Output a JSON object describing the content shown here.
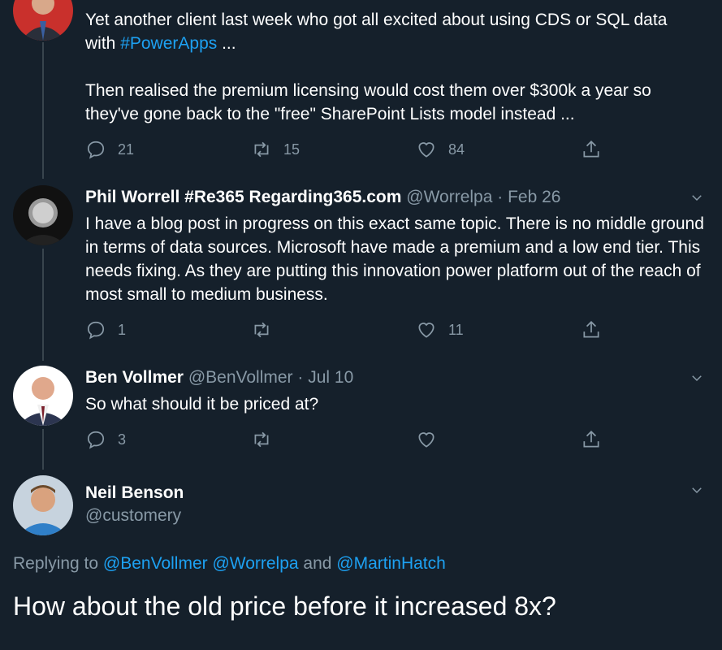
{
  "tweet1": {
    "text_line1": "Yet another client last week who got all excited about using CDS or SQL data",
    "text_line2_prefix": "with ",
    "hashtag": "#PowerApps",
    "text_line2_suffix": " ...",
    "text_para2_line1": "Then realised the premium licensing would cost them over $300k a year so",
    "text_para2_line2": "they've gone back to the \"free\" SharePoint Lists model instead ...",
    "replies": "21",
    "retweets": "15",
    "likes": "84"
  },
  "tweet2": {
    "name": "Phil Worrell #Re365 Regarding365.com",
    "handle": "@Worrelpa",
    "date": "· Feb 26",
    "text": "I have a blog post in progress on this exact same topic. There is no middle ground in terms of data sources. Microsoft have made a premium and a low end tier. This needs fixing. As they are putting this innovation power platform out of the reach of most small to medium business.",
    "replies": "1",
    "likes": "11"
  },
  "tweet3": {
    "name": "Ben Vollmer",
    "handle": "@BenVollmer",
    "date": "· Jul 10",
    "text": "So what should it be priced at?",
    "replies": "3"
  },
  "tweet4": {
    "name": "Neil Benson",
    "handle": "@customery",
    "replying_prefix": "Replying to ",
    "replying_to": "@BenVollmer @Worrelpa",
    "replying_and": " and ",
    "replying_last": "@MartinHatch",
    "text": "How about the old price before it increased 8x?"
  },
  "icons": {
    "reply": "reply-icon",
    "retweet": "retweet-icon",
    "like": "heart-icon",
    "share": "share-icon",
    "more": "chevron-down-icon"
  },
  "colors": {
    "background": "#15202b",
    "link": "#1da1f2",
    "muted": "#8899a6",
    "line": "#38444d"
  }
}
